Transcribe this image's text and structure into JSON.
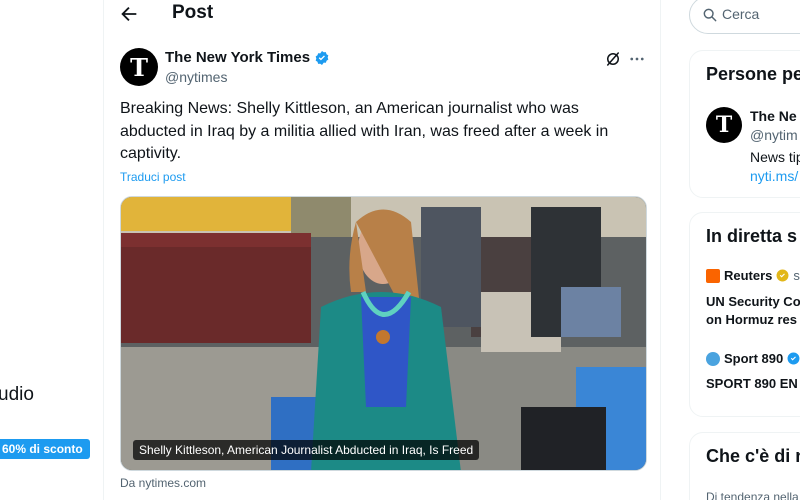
{
  "left_nav": {
    "partial_label": "udio",
    "promo_badge": "60% di sconto"
  },
  "header": {
    "title": "Post"
  },
  "tweet": {
    "author_name": "The New York Times",
    "author_handle": "@nytimes",
    "avatar_letter": "T",
    "text": "Breaking News: Shelly Kittleson, an American journalist who was abducted in Iraq by a militia allied with Iran, was freed after a week in captivity.",
    "translate_label": "Traduci post",
    "media_caption": "Shelly Kittleson, American Journalist Abducted in Iraq, Is Freed",
    "source": "Da nytimes.com"
  },
  "search": {
    "placeholder": "Cerca"
  },
  "who_to_follow": {
    "title": "Persone pe",
    "person": {
      "name": "The Ne",
      "handle": "@nytim",
      "bio": "News tip",
      "link": "nyti.ms/"
    }
  },
  "live": {
    "title": "In diretta s",
    "items": [
      {
        "source": "Reuters",
        "sub": "st",
        "headline_line1": "UN Security Co",
        "headline_line2": "on Hormuz res"
      },
      {
        "source": "Sport 890",
        "sub": "",
        "headline_line1": "SPORT 890 EN",
        "headline_line2": ""
      }
    ]
  },
  "whats_happening": {
    "title": "Che c'è di n",
    "subtitle": "Di tendenza nella"
  },
  "colors": {
    "accent": "#1d9bf0",
    "text": "#0f1419",
    "muted": "#536471",
    "border": "#eff3f4"
  }
}
